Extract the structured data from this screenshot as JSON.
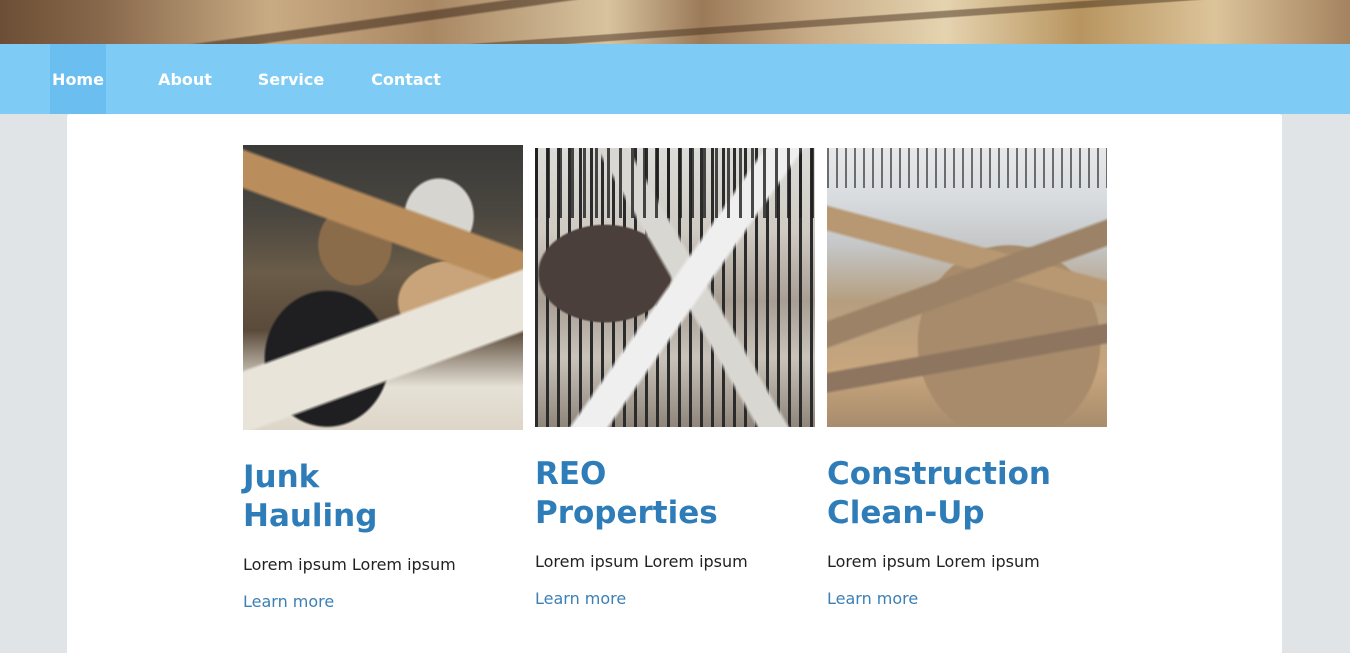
{
  "nav": {
    "items": [
      {
        "label": "Home",
        "active": true
      },
      {
        "label": "About",
        "active": false
      },
      {
        "label": "Service",
        "active": false
      },
      {
        "label": "Contact",
        "active": false
      }
    ]
  },
  "cards": [
    {
      "title": "Junk\nHauling",
      "text": "Lorem ipsum Lorem ipsum",
      "link": "Learn more"
    },
    {
      "title": "REO\nProperties",
      "text": "Lorem ipsum Lorem ipsum",
      "link": "Learn more"
    },
    {
      "title": "Construction\nClean-Up",
      "text": "Lorem ipsum Lorem ipsum",
      "link": "Learn more"
    }
  ],
  "colors": {
    "nav_bg": "#7ecbf5",
    "nav_active": "#6bbef0",
    "title": "#2e7db9",
    "link": "#3b7fb5",
    "page_bg": "#e1e4e6"
  }
}
